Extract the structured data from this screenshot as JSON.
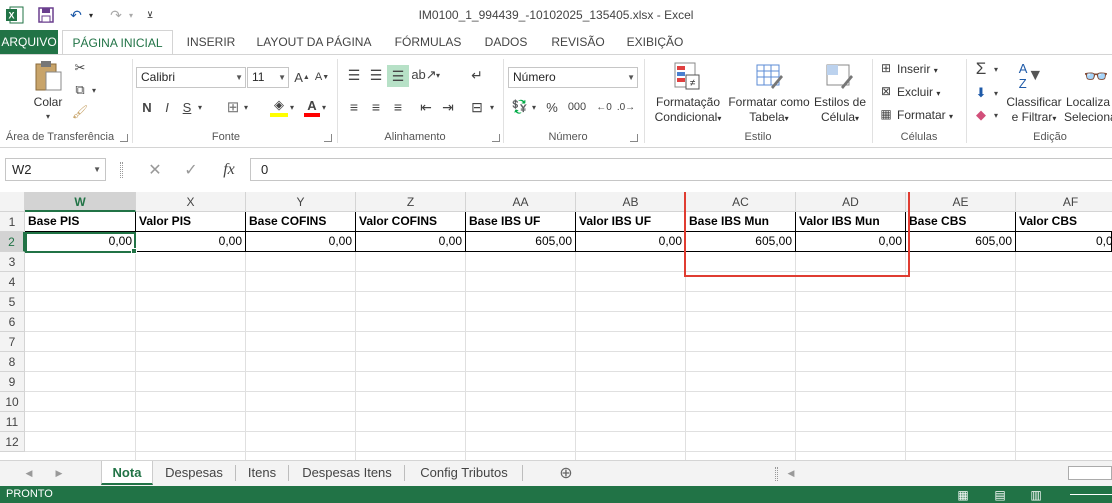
{
  "window": {
    "title": "IM0100_1_994439_-10102025_135405.xlsx - Excel"
  },
  "quick_access": {
    "excel_icon": "excel-logo-icon",
    "save_icon": "save-icon",
    "undo_icon": "undo-icon",
    "redo_icon": "redo-icon",
    "customize_icon": "customize-qat-icon"
  },
  "ribbon_tabs": [
    "ARQUIVO",
    "PÁGINA INICIAL",
    "INSERIR",
    "LAYOUT DA PÁGINA",
    "FÓRMULAS",
    "DADOS",
    "REVISÃO",
    "EXIBIÇÃO"
  ],
  "ribbon": {
    "clipboard": {
      "paste_label": "Colar",
      "group_label": "Área de Transferência"
    },
    "font": {
      "font_name": "Calibri",
      "font_size": "11",
      "bold": "N",
      "italic": "I",
      "underline": "S",
      "group_label": "Fonte"
    },
    "alignment": {
      "group_label": "Alinhamento"
    },
    "number": {
      "format": "Número",
      "group_label": "Número",
      "percent": "%",
      "thousands": "000"
    },
    "styles": {
      "conditional_line1": "Formatação",
      "conditional_line2": "Condicional",
      "table_line1": "Formatar como",
      "table_line2": "Tabela",
      "cell_line1": "Estilos de",
      "cell_line2": "Célula",
      "group_label": "Estilo"
    },
    "cells": {
      "insert": "Inserir",
      "delete": "Excluir",
      "format": "Formatar",
      "group_label": "Células"
    },
    "editing": {
      "sort_line1": "Classificar",
      "sort_line2": "e Filtrar",
      "find_line1": "Localiza",
      "find_line2": "Seleciona",
      "group_label": "Edição"
    }
  },
  "formula_bar": {
    "name_box": "W2",
    "fx": "fx",
    "value": "0"
  },
  "grid": {
    "columns": [
      "W",
      "X",
      "Y",
      "Z",
      "AA",
      "AB",
      "AC",
      "AD",
      "AE",
      "AF"
    ],
    "selected_column": "W",
    "rows": [
      "1",
      "2",
      "3",
      "4",
      "5",
      "6",
      "7",
      "8",
      "9",
      "10",
      "11",
      "12"
    ],
    "selected_row": "2",
    "header_row": [
      "Base PIS",
      "Valor PIS",
      "Base COFINS",
      "Valor COFINS",
      "Base IBS UF",
      "Valor IBS UF",
      "Base IBS Mun",
      "Valor IBS Mun",
      "Base CBS",
      "Valor CBS"
    ],
    "data_row": [
      "0,00",
      "0,00",
      "0,00",
      "0,00",
      "605,00",
      "0,00",
      "605,00",
      "0,00",
      "605,00",
      "0,0"
    ]
  },
  "sheets": {
    "tabs": [
      "Nota",
      "Despesas",
      "Itens",
      "Despesas Itens",
      "Config Tributos"
    ],
    "active": "Nota"
  },
  "status_bar": {
    "text": "PRONTO"
  },
  "colors": {
    "excel_green": "#217346",
    "highlight_red": "#e03c31"
  }
}
